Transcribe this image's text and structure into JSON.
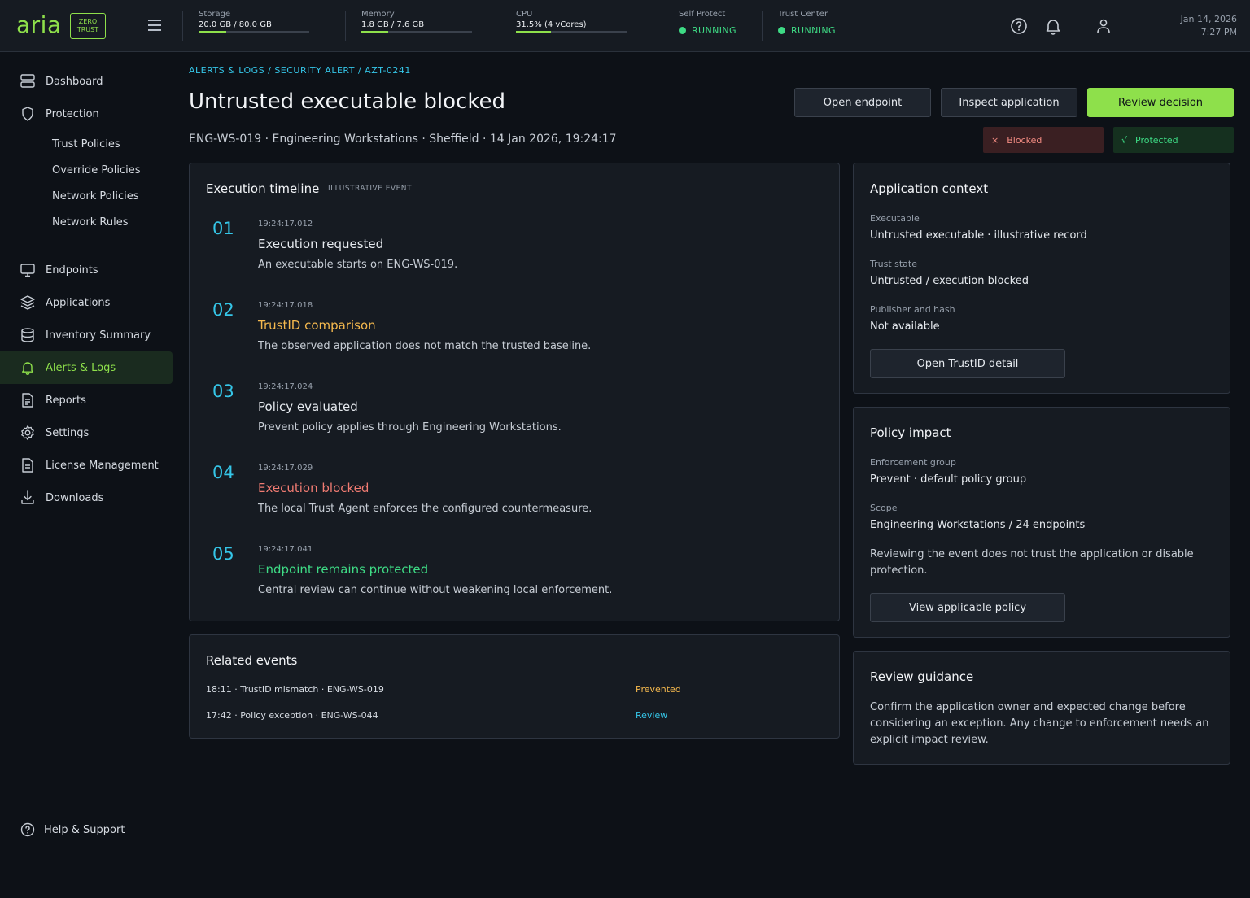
{
  "brand": {
    "name": "aria",
    "badge_line1": "ZERO",
    "badge_line2": "TRUST"
  },
  "topbar": {
    "metrics": [
      {
        "label": "Storage",
        "value": "20.0 GB / 80.0 GB",
        "fill": 0.25
      },
      {
        "label": "Memory",
        "value": "1.8 GB / 7.6 GB",
        "fill": 0.24
      },
      {
        "label": "CPU",
        "value": "31.5% (4 vCores)",
        "fill": 0.315
      }
    ],
    "statuses": [
      {
        "label": "Self Protect",
        "value": "RUNNING"
      },
      {
        "label": "Trust Center",
        "value": "RUNNING"
      }
    ],
    "date": "Jan 14, 2026",
    "time": "7:27 PM",
    "accent": "#8ee04b",
    "ok": "#3edb85"
  },
  "sidebar": {
    "items": [
      {
        "label": "Dashboard",
        "icon": "dashboard-icon"
      },
      {
        "label": "Protection",
        "icon": "shield-icon"
      },
      {
        "label": "Endpoints",
        "icon": "monitor-icon"
      },
      {
        "label": "Applications",
        "icon": "layers-icon"
      },
      {
        "label": "Inventory Summary",
        "icon": "database-icon"
      },
      {
        "label": "Alerts & Logs",
        "icon": "bell-icon",
        "active": true
      },
      {
        "label": "Reports",
        "icon": "report-icon"
      },
      {
        "label": "Settings",
        "icon": "gear-icon"
      },
      {
        "label": "License Management",
        "icon": "license-icon"
      },
      {
        "label": "Downloads",
        "icon": "download-icon"
      }
    ],
    "sub_items": [
      "Trust Policies",
      "Override Policies",
      "Network Policies",
      "Network Rules"
    ],
    "help": "Help & Support"
  },
  "header": {
    "breadcrumb": "ALERTS & LOGS / SECURITY ALERT / AZT-0241",
    "title": "Untrusted executable blocked",
    "subline": "ENG-WS-019 · Engineering Workstations · Sheffield · 14 Jan 2026, 19:24:17",
    "buttons": {
      "open_endpoint": "Open endpoint",
      "inspect_application": "Inspect application",
      "review_decision": "Review decision"
    },
    "badges": {
      "blocked_symbol": "×",
      "blocked": "Blocked",
      "protected_symbol": "√",
      "protected": "Protected"
    }
  },
  "timeline": {
    "title": "Execution timeline",
    "tag": "ILLUSTRATIVE EVENT",
    "steps": [
      {
        "num": "01",
        "time": "19:24:17.012",
        "title": "Execution requested",
        "desc": "An executable starts on ENG-WS-019.",
        "color": "#e6eaef"
      },
      {
        "num": "02",
        "time": "19:24:17.018",
        "title": "TrustID comparison",
        "desc": "The observed application does not match the trusted baseline.",
        "color": "#f5b94e"
      },
      {
        "num": "03",
        "time": "19:24:17.024",
        "title": "Policy evaluated",
        "desc": "Prevent policy applies through Engineering Workstations.",
        "color": "#e6eaef"
      },
      {
        "num": "04",
        "time": "19:24:17.029",
        "title": "Execution blocked",
        "desc": "The local Trust Agent enforces the configured countermeasure.",
        "color": "#f07b72"
      },
      {
        "num": "05",
        "time": "19:24:17.041",
        "title": "Endpoint remains protected",
        "desc": "Central review can continue without weakening local enforcement.",
        "color": "#3edb85"
      }
    ]
  },
  "related": {
    "title": "Related events",
    "events": [
      {
        "text": "18:11 · TrustID mismatch · ENG-WS-019",
        "status": "Prevented",
        "color": "#f5b94e"
      },
      {
        "text": "17:42 · Policy exception · ENG-WS-044",
        "status": "Review",
        "color": "#35c6e8"
      }
    ]
  },
  "app_context": {
    "title": "Application context",
    "fields": [
      {
        "label": "Executable",
        "value": "Untrusted executable · illustrative record"
      },
      {
        "label": "Trust state",
        "value": "Untrusted / execution blocked"
      },
      {
        "label": "Publisher and hash",
        "value": "Not available"
      }
    ],
    "button": "Open TrustID detail"
  },
  "policy_impact": {
    "title": "Policy impact",
    "fields": [
      {
        "label": "Enforcement group",
        "value": "Prevent · default policy group"
      },
      {
        "label": "Scope",
        "value": "Engineering Workstations / 24 endpoints"
      }
    ],
    "note_line1": "Reviewing the event does not trust the application or disable",
    "note_line2": "protection.",
    "button": "View applicable policy"
  },
  "guidance": {
    "title": "Review guidance",
    "line1": "Confirm the application owner and expected change before",
    "line2": "considering an exception. Any change to enforcement needs an",
    "line3": "explicit impact review."
  }
}
